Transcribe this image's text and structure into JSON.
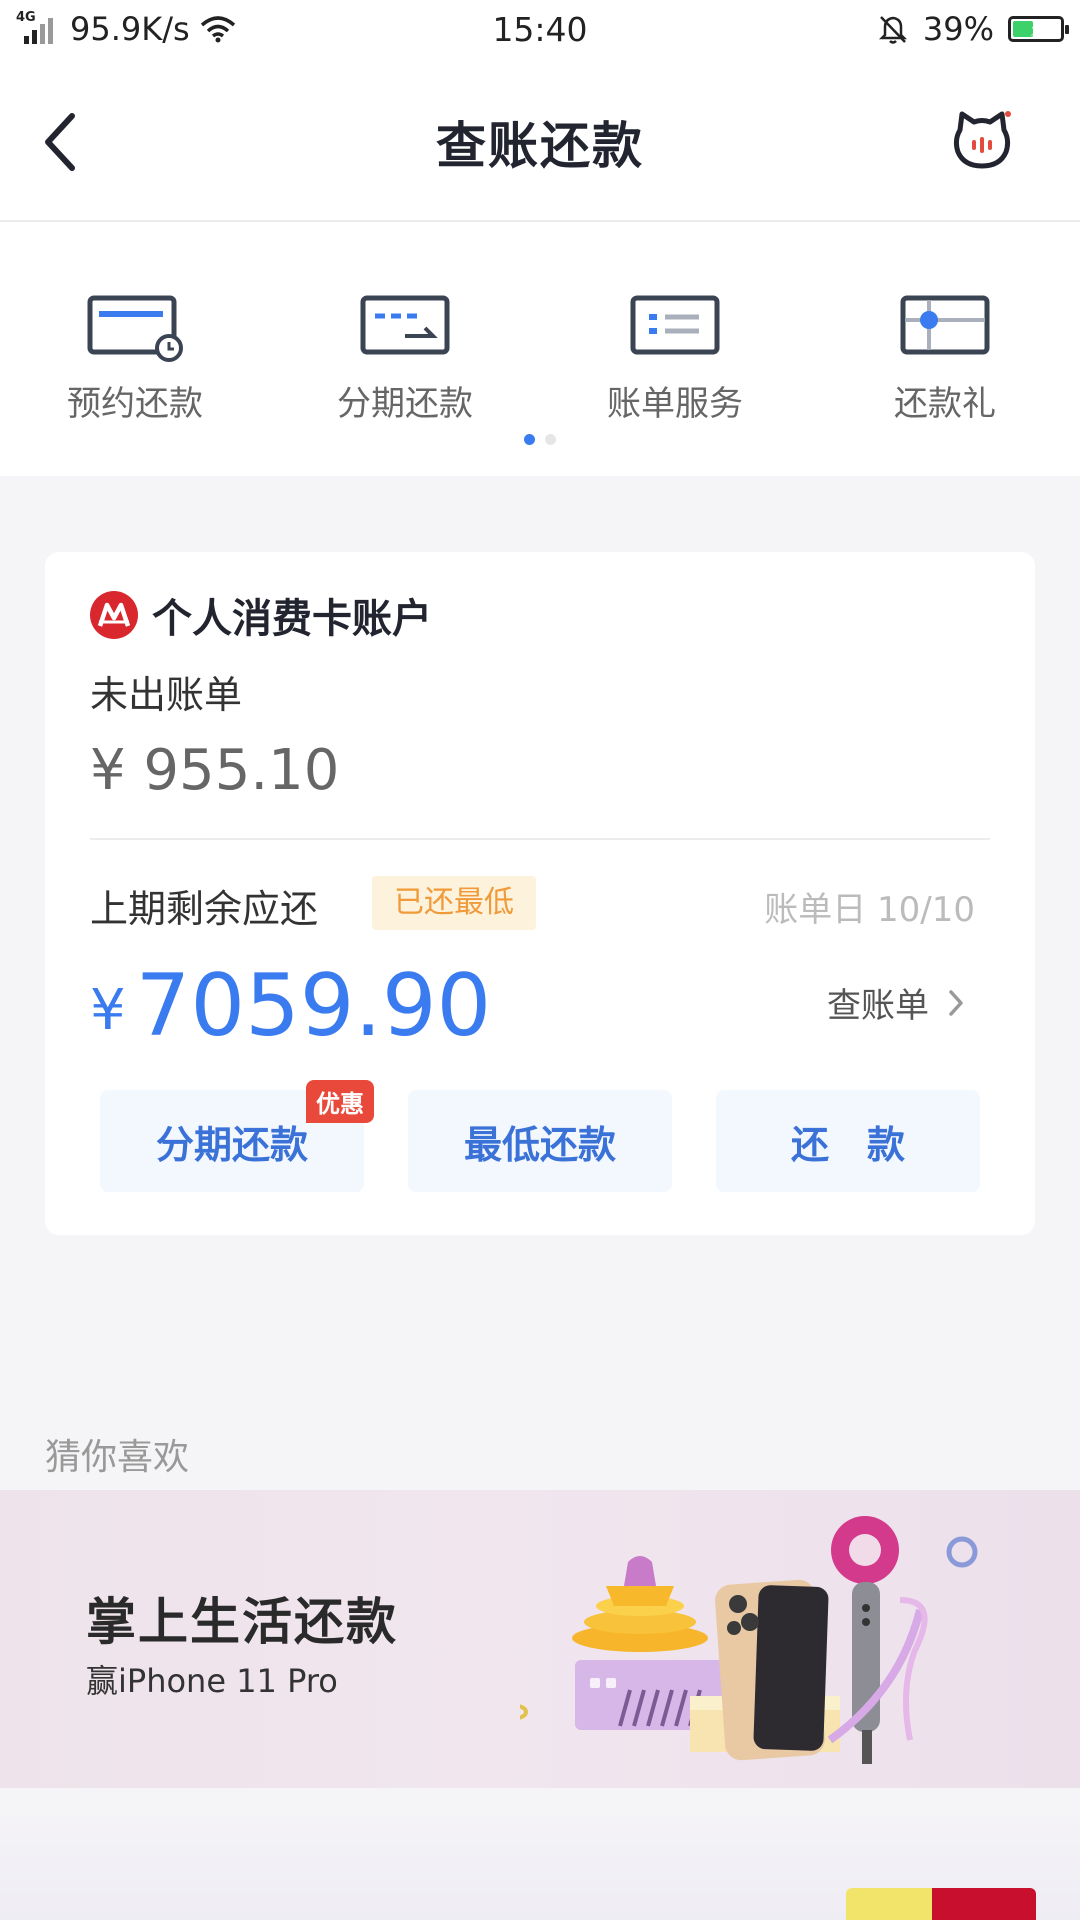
{
  "status_bar": {
    "network_type": "4G",
    "speed": "95.9K/s",
    "time": "15:40",
    "battery": "39%",
    "battery_level": 0.39,
    "icons": [
      "signal-icon",
      "wifi-icon",
      "bell-muted-icon",
      "battery-charging-icon"
    ]
  },
  "nav": {
    "title": "查账还款",
    "back_icon": "back-arrow-icon",
    "service_icon": "cat-assistant-icon"
  },
  "quick_menu": {
    "items": [
      {
        "label": "预约还款",
        "icon": "scheduled-card-icon"
      },
      {
        "label": "分期还款",
        "icon": "installment-card-icon"
      },
      {
        "label": "账单服务",
        "icon": "bill-list-icon"
      },
      {
        "label": "还款礼",
        "icon": "gift-icon"
      }
    ],
    "pages": 2,
    "active_page": 1
  },
  "account_card": {
    "title": "个人消费卡账户",
    "logo_icon": "cmb-bank-logo-icon",
    "unbilled_label": "未出账单",
    "unbilled_amount": "¥ 955.10",
    "previous_label": "上期剩余应还",
    "status_badge": "已还最低",
    "bill_date": "账单日 10/10",
    "due_currency": "¥",
    "due_amount": "7059.90",
    "check_bill_label": "查账单",
    "actions": [
      {
        "label": "分期还款",
        "tag": "优惠"
      },
      {
        "label": "最低还款"
      },
      {
        "label": "还　款"
      }
    ]
  },
  "recommend": {
    "section_title": "猜你喜欢",
    "banner_title": "掌上生活还款",
    "banner_subtitle": "赢iPhone 11 Pro"
  },
  "colors": {
    "accent_blue": "#3a7cf0",
    "button_text_blue": "#3a72d8",
    "promo_red": "#e8493a",
    "badge_bg": "#fdf2dc",
    "badge_text": "#f09a3a",
    "bank_red": "#d9272e"
  }
}
